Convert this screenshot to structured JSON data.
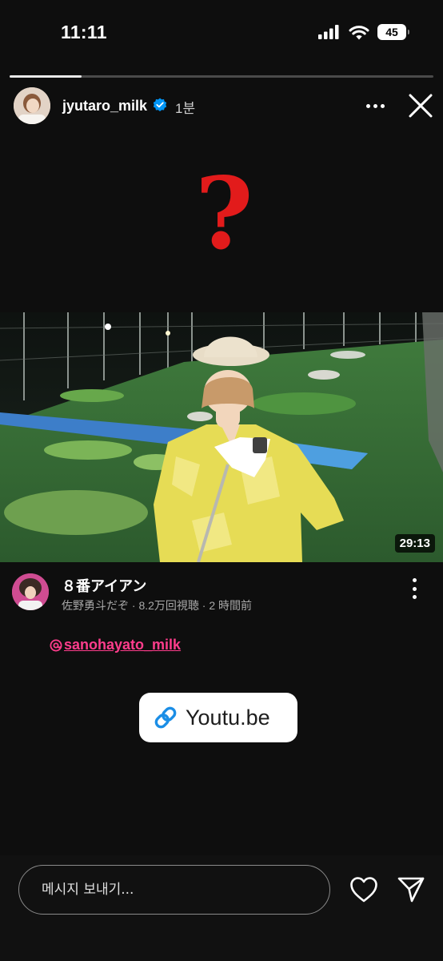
{
  "status_bar": {
    "time": "11:11",
    "battery": "45"
  },
  "story": {
    "progress_fraction": 0.17,
    "username": "jyutaro_milk",
    "time_ago": "1분"
  },
  "overlay": {
    "question_mark": "?"
  },
  "video": {
    "duration": "29:13",
    "title": "８番アイアン",
    "meta": "佐野勇斗だぞ · 8.2万回視聴 · 2 時間前"
  },
  "mention": {
    "text": "sanohayato_milk"
  },
  "link_sticker": {
    "label": "Youtu.be"
  },
  "reply": {
    "placeholder": "메시지 보내기..."
  },
  "colors": {
    "accent_pink": "#ff3d8c",
    "question_red": "#e21b1b",
    "verified_blue": "#0095f6",
    "link_blue": "#1b8ee6"
  }
}
